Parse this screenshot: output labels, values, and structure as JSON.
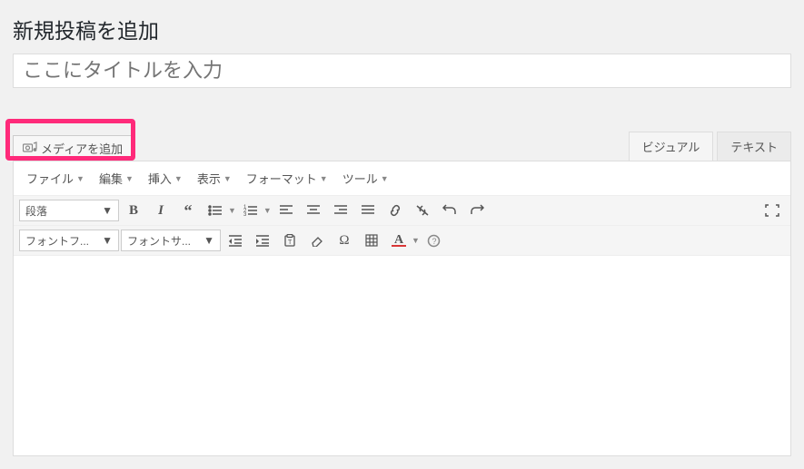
{
  "page": {
    "title": "新規投稿を追加"
  },
  "title_input": {
    "placeholder": "ここにタイトルを入力"
  },
  "media_button": {
    "label": "メディアを追加"
  },
  "editor_tabs": {
    "visual": "ビジュアル",
    "text": "テキスト"
  },
  "menu": {
    "file": "ファイル",
    "edit": "編集",
    "insert": "挿入",
    "view": "表示",
    "format": "フォーマット",
    "tools": "ツール"
  },
  "toolbar": {
    "paragraph": "段落",
    "font_family": "フォントフ...",
    "font_size": "フォントサ..."
  }
}
